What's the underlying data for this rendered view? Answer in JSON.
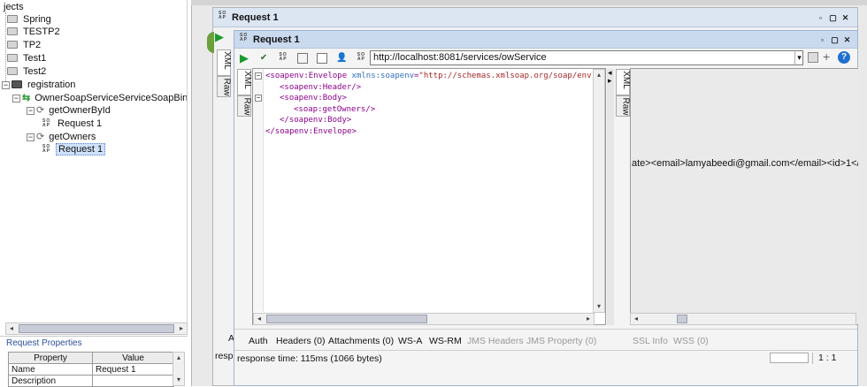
{
  "tree": {
    "header": "jects",
    "projects": [
      "Spring",
      "TESTP2",
      "TP2",
      "Test1",
      "Test2"
    ],
    "registration": "registration",
    "binding": "OwnerSoapServiceServiceSoapBinding",
    "op1": "getOwnerById",
    "op1_request": "Request 1",
    "op2": "getOwners",
    "op2_request": "Request 1",
    "collapse_glyph": "−"
  },
  "icons": {
    "soap": "SO\nAP",
    "play": "▶",
    "check": "✔",
    "minimize": "▫",
    "maximize": "▢",
    "close": "✕",
    "dropdown": "▾",
    "plus": "+",
    "help": "?",
    "left": "◂",
    "right": "▸",
    "up": "▴",
    "down": "▾"
  },
  "props": {
    "title": "Request Properties",
    "col_property": "Property",
    "col_value": "Value",
    "rows": [
      {
        "name": "Name",
        "value": "Request 1"
      },
      {
        "name": "Description",
        "value": ""
      }
    ]
  },
  "outer_window": {
    "title": "Request 1"
  },
  "inner_window": {
    "title": "Request 1"
  },
  "endpoint": {
    "url": "http://localhost:8081/services/owService"
  },
  "request": {
    "tabs": [
      "XML",
      "Raw"
    ],
    "xml_lines": [
      {
        "indent": 0,
        "parts": [
          [
            "tag",
            "<soapenv:Envelope "
          ],
          [
            "attr",
            "xmlns:soapenv"
          ],
          [
            "tag",
            "="
          ],
          [
            "str",
            "\"http://schemas.xmlsoap.org/soap/env"
          ]
        ]
      },
      {
        "indent": 1,
        "parts": [
          [
            "tag",
            "<soapenv:Header/>"
          ]
        ]
      },
      {
        "indent": 1,
        "parts": [
          [
            "tag",
            "<soapenv:Body>"
          ]
        ]
      },
      {
        "indent": 2,
        "parts": [
          [
            "tag",
            "<soap:getOwners/>"
          ]
        ]
      },
      {
        "indent": 1,
        "parts": [
          [
            "tag",
            "</soapenv:Body>"
          ]
        ]
      },
      {
        "indent": 0,
        "parts": [
          [
            "tag",
            "</soapenv:Envelope>"
          ]
        ]
      }
    ]
  },
  "response": {
    "tabs": [
      "XML",
      "Raw"
    ],
    "text": "ate><email>lamyabeedi@gmail.com</email><id>1</"
  },
  "bottom_tabs": {
    "auth": "Auth",
    "headers": "Headers (0)",
    "attachments": "Attachments (0)",
    "wsa": "WS-A",
    "wsrm": "WS-RM",
    "jms_headers": "JMS Headers",
    "jms_property": "JMS Property (0)",
    "ssl": "SSL Info",
    "wss": "WSS (0)"
  },
  "outer_side": {
    "a_label": "A",
    "resp_label": "resp"
  },
  "status": {
    "text": "response time: 115ms (1066 bytes)",
    "position": "1 : 1"
  }
}
